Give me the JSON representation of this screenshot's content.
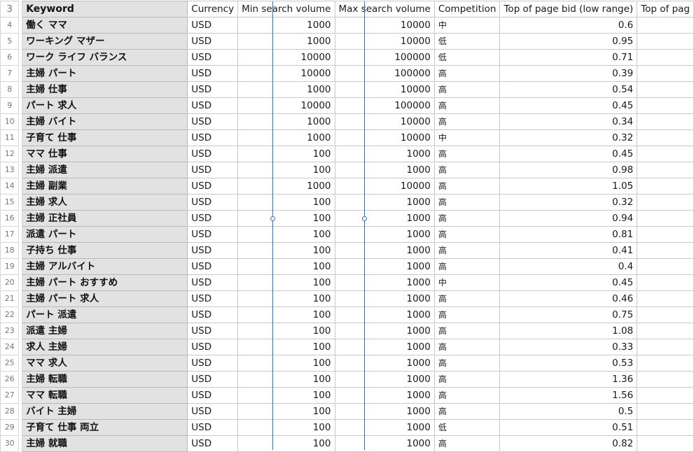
{
  "columns": {
    "keyword": "Keyword",
    "currency": "Currency",
    "min_volume": "Min search volume",
    "max_volume": "Max search volume",
    "competition": "Competition",
    "bid_low": "Top of page bid (low range)",
    "bid_high_partial": "Top of pag"
  },
  "header_row_number": "3",
  "rows": [
    {
      "n": "4",
      "kw": "働く ママ",
      "cur": "USD",
      "min": "1000",
      "max": "10000",
      "comp": "中",
      "bid": "0.6"
    },
    {
      "n": "5",
      "kw": "ワーキング マザー",
      "cur": "USD",
      "min": "1000",
      "max": "10000",
      "comp": "低",
      "bid": "0.95"
    },
    {
      "n": "6",
      "kw": "ワーク ライフ バランス",
      "cur": "USD",
      "min": "10000",
      "max": "100000",
      "comp": "低",
      "bid": "0.71"
    },
    {
      "n": "7",
      "kw": "主婦 パート",
      "cur": "USD",
      "min": "10000",
      "max": "100000",
      "comp": "高",
      "bid": "0.39"
    },
    {
      "n": "8",
      "kw": "主婦 仕事",
      "cur": "USD",
      "min": "1000",
      "max": "10000",
      "comp": "高",
      "bid": "0.54"
    },
    {
      "n": "9",
      "kw": "パート 求人",
      "cur": "USD",
      "min": "10000",
      "max": "100000",
      "comp": "高",
      "bid": "0.45"
    },
    {
      "n": "10",
      "kw": "主婦 バイト",
      "cur": "USD",
      "min": "1000",
      "max": "10000",
      "comp": "高",
      "bid": "0.34"
    },
    {
      "n": "11",
      "kw": "子育て 仕事",
      "cur": "USD",
      "min": "1000",
      "max": "10000",
      "comp": "中",
      "bid": "0.32"
    },
    {
      "n": "12",
      "kw": "ママ 仕事",
      "cur": "USD",
      "min": "100",
      "max": "1000",
      "comp": "高",
      "bid": "0.45"
    },
    {
      "n": "13",
      "kw": "主婦 派遣",
      "cur": "USD",
      "min": "100",
      "max": "1000",
      "comp": "高",
      "bid": "0.98"
    },
    {
      "n": "14",
      "kw": "主婦 副業",
      "cur": "USD",
      "min": "1000",
      "max": "10000",
      "comp": "高",
      "bid": "1.05"
    },
    {
      "n": "15",
      "kw": "主婦 求人",
      "cur": "USD",
      "min": "100",
      "max": "1000",
      "comp": "高",
      "bid": "0.32"
    },
    {
      "n": "16",
      "kw": "主婦 正社員",
      "cur": "USD",
      "min": "100",
      "max": "1000",
      "comp": "高",
      "bid": "0.94"
    },
    {
      "n": "17",
      "kw": "派遣 パート",
      "cur": "USD",
      "min": "100",
      "max": "1000",
      "comp": "高",
      "bid": "0.81"
    },
    {
      "n": "18",
      "kw": "子持ち 仕事",
      "cur": "USD",
      "min": "100",
      "max": "1000",
      "comp": "高",
      "bid": "0.41"
    },
    {
      "n": "19",
      "kw": "主婦 アルバイト",
      "cur": "USD",
      "min": "100",
      "max": "1000",
      "comp": "高",
      "bid": "0.4"
    },
    {
      "n": "20",
      "kw": "主婦 パート おすすめ",
      "cur": "USD",
      "min": "100",
      "max": "1000",
      "comp": "中",
      "bid": "0.45"
    },
    {
      "n": "21",
      "kw": "主婦 パート 求人",
      "cur": "USD",
      "min": "100",
      "max": "1000",
      "comp": "高",
      "bid": "0.46"
    },
    {
      "n": "22",
      "kw": "パート 派遣",
      "cur": "USD",
      "min": "100",
      "max": "1000",
      "comp": "高",
      "bid": "0.75"
    },
    {
      "n": "23",
      "kw": "派遣 主婦",
      "cur": "USD",
      "min": "100",
      "max": "1000",
      "comp": "高",
      "bid": "1.08"
    },
    {
      "n": "24",
      "kw": "求人 主婦",
      "cur": "USD",
      "min": "100",
      "max": "1000",
      "comp": "高",
      "bid": "0.33"
    },
    {
      "n": "25",
      "kw": "ママ 求人",
      "cur": "USD",
      "min": "100",
      "max": "1000",
      "comp": "高",
      "bid": "0.53"
    },
    {
      "n": "26",
      "kw": "主婦 転職",
      "cur": "USD",
      "min": "100",
      "max": "1000",
      "comp": "高",
      "bid": "1.36"
    },
    {
      "n": "27",
      "kw": "ママ 転職",
      "cur": "USD",
      "min": "100",
      "max": "1000",
      "comp": "高",
      "bid": "1.56"
    },
    {
      "n": "28",
      "kw": "バイト 主婦",
      "cur": "USD",
      "min": "100",
      "max": "1000",
      "comp": "高",
      "bid": "0.5"
    },
    {
      "n": "29",
      "kw": "子育て 仕事 両立",
      "cur": "USD",
      "min": "100",
      "max": "1000",
      "comp": "低",
      "bid": "0.51"
    },
    {
      "n": "30",
      "kw": "主婦 就職",
      "cur": "USD",
      "min": "100",
      "max": "1000",
      "comp": "高",
      "bid": "0.82"
    }
  ]
}
